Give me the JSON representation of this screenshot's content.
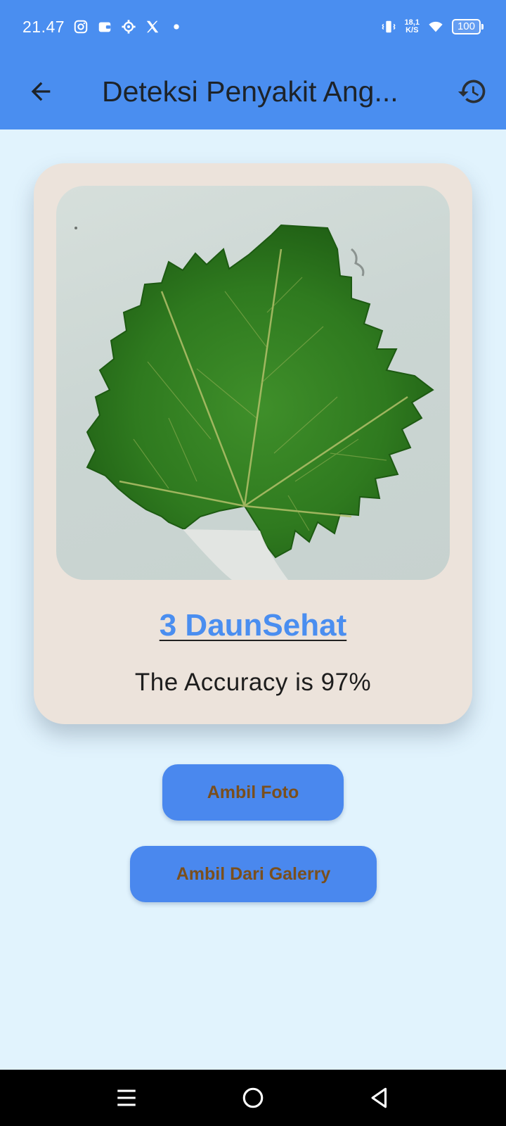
{
  "status_bar": {
    "time": "21.47",
    "net_speed_value": "18,1",
    "net_speed_unit": "K/S",
    "battery": "100",
    "icons": [
      "instagram-icon",
      "wallet-icon",
      "settings-gear-icon",
      "x-icon",
      "dot-icon",
      "vibrate-icon",
      "wifi-icon",
      "battery-icon"
    ]
  },
  "app_bar": {
    "title": "Deteksi Penyakit Ang...",
    "back_icon": "arrow-left-icon",
    "history_icon": "history-icon"
  },
  "result_card": {
    "image": "grape-leaf-photo",
    "label": "3 DaunSehat",
    "accuracy": "The Accuracy is 97%"
  },
  "buttons": {
    "take_photo": "Ambil Foto",
    "from_gallery": "Ambil Dari Galerry"
  },
  "nav_bar": {
    "icons": [
      "menu-icon",
      "home-circle-icon",
      "back-triangle-icon"
    ]
  },
  "colors": {
    "primary": "#4a8ef0",
    "background": "#e1f3fd",
    "card": "#ece3db",
    "button_text": "#7a4f1d"
  }
}
